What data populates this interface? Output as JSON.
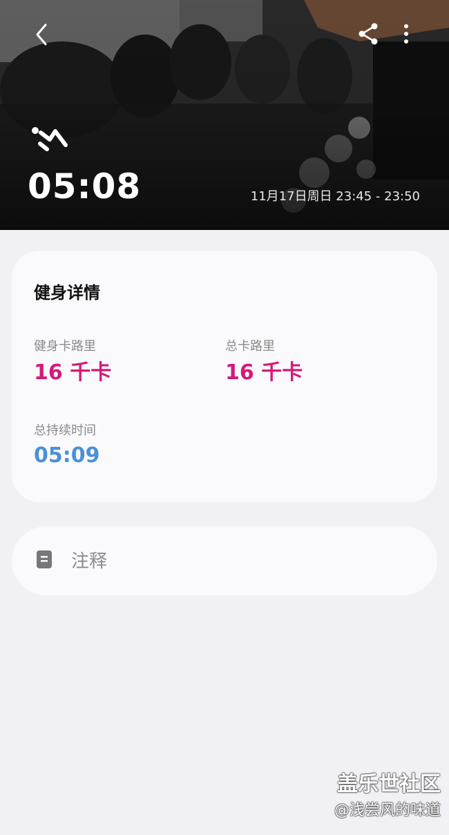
{
  "header": {
    "duration": "05:08",
    "time_range": "11月17日周日 23:45 - 23:50",
    "icons": {
      "back": "chevron-left-icon",
      "share": "share-icon",
      "more": "more-vertical-icon",
      "exercise": "workout-person-icon"
    }
  },
  "details": {
    "title": "健身详情",
    "workout_calories": {
      "label": "健身卡路里",
      "value": "16 千卡"
    },
    "total_calories": {
      "label": "总卡路里",
      "value": "16 千卡"
    },
    "total_duration": {
      "label": "总持续时间",
      "value": "05:09"
    }
  },
  "notes": {
    "label": "注释",
    "icon": "note-icon"
  },
  "watermark": {
    "line1": "盖乐世社区",
    "line2": "@浅尝风的味道"
  },
  "colors": {
    "calorie": "#d4197a",
    "duration": "#4a90d9",
    "background": "#f0f0f5",
    "card": "#fafafc"
  }
}
